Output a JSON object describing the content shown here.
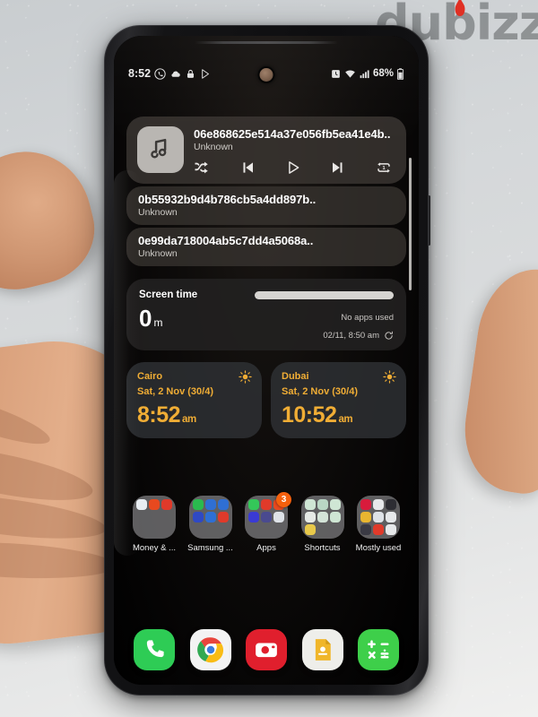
{
  "watermark": {
    "text": "dubizzle",
    "flame_color": "#e03024"
  },
  "status_bar": {
    "time": "8:52",
    "left_icons": [
      "whatsapp-icon",
      "cloud-icon",
      "lock-icon",
      "play-store-icon"
    ],
    "right_icons": [
      "alarm-icon",
      "wifi-icon",
      "signal-icon"
    ],
    "battery_percent": "68%",
    "battery_icon": "battery-icon"
  },
  "media_widget": {
    "album_art_icon": "music-note-icon",
    "title": "06e868625e514a37e056fb5ea41e4b..",
    "subtitle": "Unknown",
    "controls": [
      {
        "name": "shuffle-button",
        "icon": "shuffle-icon"
      },
      {
        "name": "previous-track-button",
        "icon": "skip-previous-icon"
      },
      {
        "name": "play-button",
        "icon": "play-icon"
      },
      {
        "name": "next-track-button",
        "icon": "skip-next-icon"
      },
      {
        "name": "repeat-button",
        "icon": "repeat-one-icon"
      }
    ],
    "queue": [
      {
        "title": "0b55932b9d4b786cb5a4dd897b..",
        "subtitle": "Unknown"
      },
      {
        "title": "0e99da718004ab5c7dd4a5068a..",
        "subtitle": "Unknown"
      }
    ]
  },
  "screen_time_widget": {
    "label": "Screen time",
    "value": "0",
    "unit": "m",
    "no_apps_text": "No apps used",
    "timestamp": "02/11, 8:50 am",
    "refresh_icon": "refresh-icon",
    "progress_percent": 100,
    "bar_color": "#d6d4d1"
  },
  "clock_widgets": [
    {
      "city": "Cairo",
      "date": "Sat, 2 Nov (30/4)",
      "time": "8:52",
      "meridiem": "am",
      "weather_icon": "sun-icon",
      "accent": "#f0ad35"
    },
    {
      "city": "Dubai",
      "date": "Sat, 2 Nov (30/4)",
      "time": "10:52",
      "meridiem": "am",
      "weather_icon": "sun-icon",
      "accent": "#f0ad35"
    }
  ],
  "folders": [
    {
      "label": "Money & ...",
      "badge": null,
      "icons": [
        "#e8edf2",
        "#e8491f",
        "#e03a2a",
        "",
        "",
        "",
        "",
        "",
        ""
      ]
    },
    {
      "label": "Samsung ...",
      "badge": null,
      "icons": [
        "#2aba4e",
        "#2f6fd4",
        "#2f6fd4",
        "#2f49c4",
        "#2f6fd4",
        "#e03a2a",
        "",
        "",
        ""
      ]
    },
    {
      "label": "Apps",
      "badge": "3",
      "icons": [
        "#34c759",
        "#e03a2a",
        "#e8491f",
        "#3a3ad4",
        "#4a4a8f",
        "#dfe3e8",
        "",
        "",
        ""
      ]
    },
    {
      "label": "Shortcuts",
      "badge": null,
      "icons": [
        "#cfe6d4",
        "#b9d6c4",
        "#cfe6d4",
        "#e6eae6",
        "#d4e4d8",
        "#cfe6d4",
        "#e8c94a",
        "",
        ""
      ]
    },
    {
      "label": "Mostly used",
      "badge": null,
      "icons": [
        "#d81b3c",
        "#e6e8ea",
        "#2d2d33",
        "#e8b530",
        "#dfe3e8",
        "#e6e8ea",
        "#3a3a44",
        "#e03a2a",
        "#e6e8ea"
      ]
    }
  ],
  "dock": [
    {
      "name": "phone-app",
      "label": "Phone",
      "icon": "phone-icon",
      "bg": "#2ecc55"
    },
    {
      "name": "chrome-app",
      "label": "Chrome",
      "icon": "chrome-icon",
      "bg": "#f3f3f3"
    },
    {
      "name": "camera-app",
      "label": "Camera",
      "icon": "camera-icon",
      "bg": "#e01f2d"
    },
    {
      "name": "notes-app",
      "label": "Notes",
      "icon": "note-icon",
      "bg": "#eeeeea"
    },
    {
      "name": "calculator-app",
      "label": "Calculator",
      "icon": "calculator-icon",
      "bg": "#3ecf4a"
    }
  ]
}
